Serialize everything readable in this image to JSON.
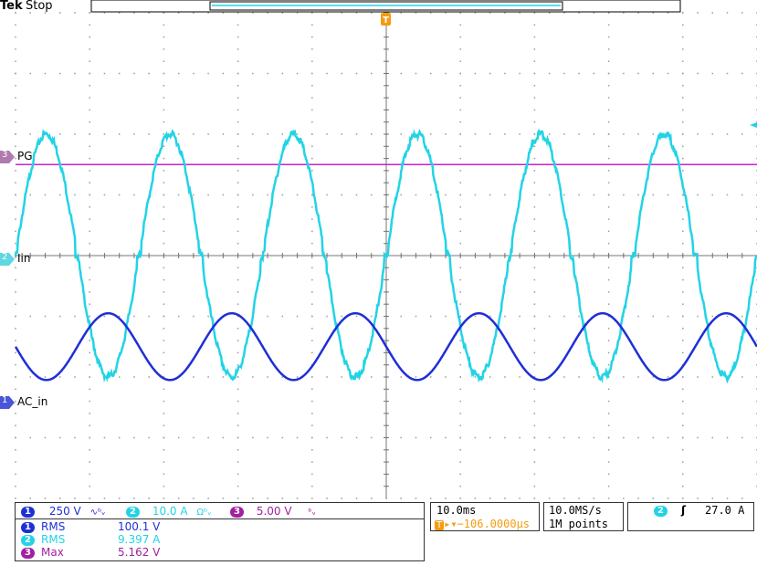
{
  "header": {
    "brand": "Tek",
    "state": "Stop",
    "trigger_marker": "T"
  },
  "colors": {
    "ch1": "#1f2fd6",
    "ch2": "#22d3e6",
    "ch3": "#cc22cc",
    "trigger": "#f39c12",
    "grid": "#9a9a9a"
  },
  "channel_markers": {
    "ch3_label": "PG",
    "ch3_number": "3",
    "ch2_label": "Iin",
    "ch2_number": "2",
    "ch1_label": "AC_in",
    "ch1_number": "1"
  },
  "bottom_bar": {
    "ch1": {
      "number": "1",
      "scale": "250 V",
      "coupling_icon": "ac-coupling-icon",
      "coupling_glyph": "∿ᵇᵥ"
    },
    "ch2": {
      "number": "2",
      "scale": "10.0 A",
      "coupling_icon": "omega-bw-icon",
      "coupling_glyph": "Ωᵇᵥ"
    },
    "ch3": {
      "number": "3",
      "scale": "5.00 V",
      "coupling_icon": "bw-icon",
      "coupling_glyph": "ᵇᵥ"
    },
    "timebase": "10.0ms",
    "trigger_position": "▸▾−106.0000µs",
    "trigger_position_prefix": "T",
    "sample_rate": "10.0MS/s",
    "record_length": "1M points",
    "trigger_source": "2",
    "trigger_slope_glyph": "ʃ",
    "trigger_level": "27.0 A"
  },
  "measurements": [
    {
      "channel": "1",
      "type": "RMS",
      "value": "100.1 V"
    },
    {
      "channel": "2",
      "type": "RMS",
      "value": "9.397 A"
    },
    {
      "channel": "3",
      "type": "Max",
      "value": "5.162 V"
    }
  ],
  "chart_data": {
    "type": "line",
    "title": "",
    "xlabel": "",
    "ylabel": "",
    "x_divisions": 10,
    "y_divisions": 8,
    "time_per_division_ms": 10.0,
    "grid": true,
    "series": [
      {
        "name": "PG",
        "channel": 3,
        "shape": "dc",
        "level_div": 1.5,
        "scale": "5.00 V/div"
      },
      {
        "name": "Iin",
        "channel": 2,
        "shape": "sine_with_zero_crossing_flats",
        "cycles_visible": 6,
        "amplitude_div": 2.0,
        "offset_div": 0,
        "scale": "10.0 A/div"
      },
      {
        "name": "AC_in",
        "channel": 1,
        "shape": "sine",
        "cycles_visible": 6,
        "amplitude_div": 0.55,
        "offset_div": -1.5,
        "scale": "250 V/div"
      }
    ]
  }
}
